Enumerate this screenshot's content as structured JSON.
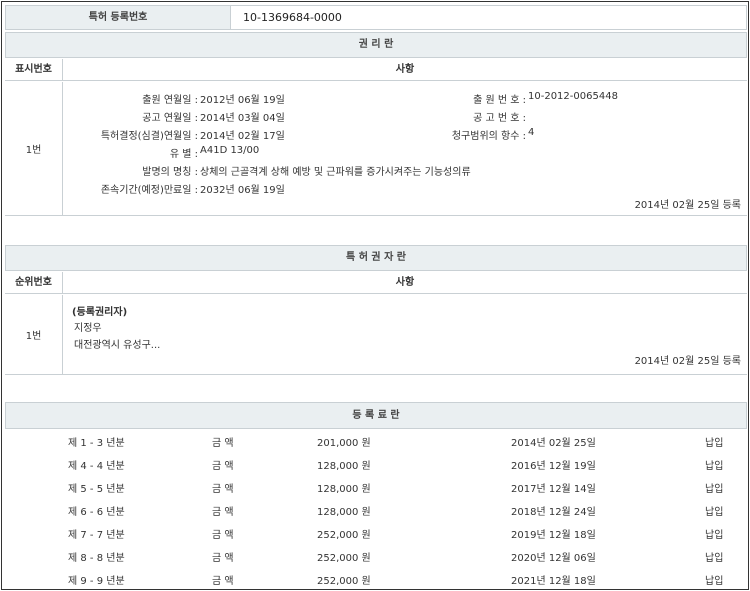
{
  "patent": {
    "label": "특허 등록번호",
    "number": "10-1369684-0000"
  },
  "rights": {
    "title": "권 리 란",
    "col_num": "표시번호",
    "col_item": "사항",
    "entry_num": "1번",
    "filing_date_label": "출원 연월일 :",
    "filing_date": "2012년 06월 19일",
    "app_no_label": "출 원 번 호 :",
    "app_no": "10-2012-0065448",
    "pub_date_label": "공고 연월일 :",
    "pub_date": "2014년 03월 04일",
    "pub_no_label": "공 고 번 호 :",
    "pub_no": "",
    "decision_label": "특허결정(심결)연월일 :",
    "decision_date": "2014년 02월 17일",
    "claims_label": "청구범위의 항수 :",
    "claims": "4",
    "class_label": "유 별 :",
    "class": "A41D 13/00",
    "title_label": "발명의 명칭 :",
    "invention": "상체의 근골격계 상해 예방 및 근파워를 증가시켜주는 기능성의류",
    "expiry_label": "존속기간(예정)만료일 :",
    "expiry": "2032년 06월 19일",
    "reg_date": "2014년 02월 25일 등록"
  },
  "holders": {
    "title": "특 허 권 자 란",
    "col_num": "순위번호",
    "col_item": "사항",
    "entry_num": "1번",
    "role": "(등록권리자)",
    "name": "지정우",
    "address": "대전광역시 유성구...",
    "reg_date": "2014년 02월 25일 등록"
  },
  "fees": {
    "title": "등 록 료 란",
    "rows": [
      {
        "period": "제 1 - 3 년분",
        "amt_label": "금 액",
        "amount": "201,000 원",
        "date": "2014년 02월 25일",
        "status": "납입"
      },
      {
        "period": "제 4 - 4 년분",
        "amt_label": "금 액",
        "amount": "128,000 원",
        "date": "2016년 12월 19일",
        "status": "납입"
      },
      {
        "period": "제 5 - 5 년분",
        "amt_label": "금 액",
        "amount": "128,000 원",
        "date": "2017년 12월 14일",
        "status": "납입"
      },
      {
        "period": "제 6 - 6 년분",
        "amt_label": "금 액",
        "amount": "128,000 원",
        "date": "2018년 12월 24일",
        "status": "납입"
      },
      {
        "period": "제 7 - 7 년분",
        "amt_label": "금 액",
        "amount": "252,000 원",
        "date": "2019년 12월 18일",
        "status": "납입"
      },
      {
        "period": "제 8 - 8 년분",
        "amt_label": "금 액",
        "amount": "252,000 원",
        "date": "2020년 12월 06일",
        "status": "납입"
      },
      {
        "period": "제 9 - 9 년분",
        "amt_label": "금 액",
        "amount": "252,000 원",
        "date": "2021년 12월 18일",
        "status": "납입"
      }
    ]
  }
}
